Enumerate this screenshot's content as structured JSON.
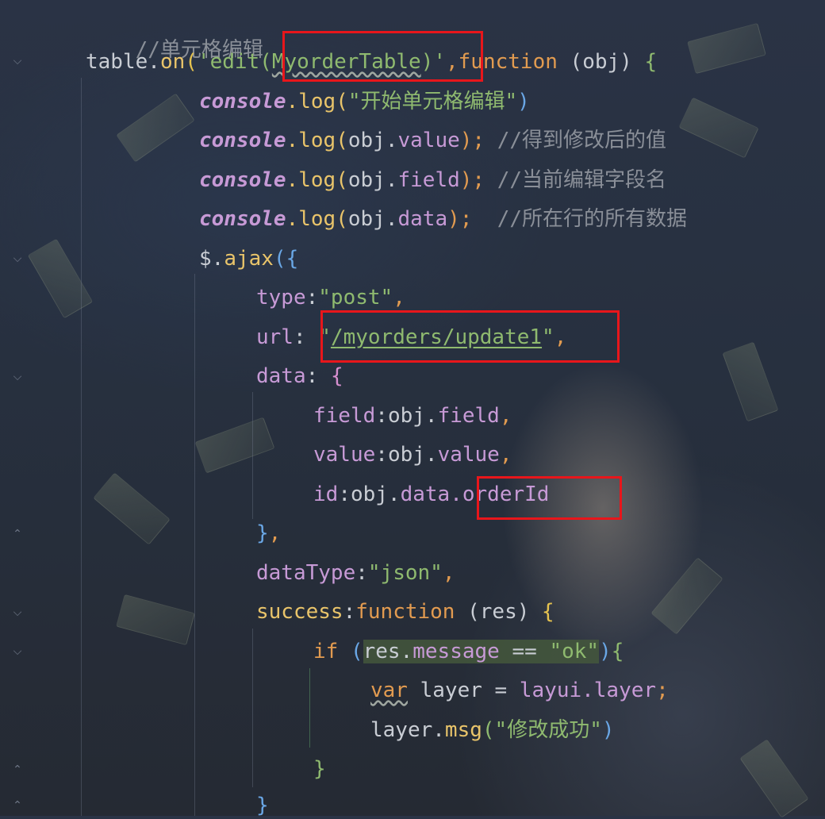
{
  "editor": {
    "comment_title": "//单元格编辑",
    "line_on": {
      "table": "table",
      "dot": ".",
      "on": "on",
      "open": "(",
      "q1": "'",
      "edit": "edit(",
      "table_name": "MyorderTable",
      "close_paren": ")",
      "q2": "'",
      "comma": ",",
      "function_kw": "function",
      "params": " (obj) ",
      "brace": "{"
    },
    "log_start": {
      "console": "console",
      "method": ".log(",
      "text": "\"开始单元格编辑\"",
      "close": ")"
    },
    "log_value": {
      "console": "console",
      "method": ".log(",
      "arg": "obj.",
      "prop": "value",
      "close": ");",
      "comment": "//得到修改后的值"
    },
    "log_field": {
      "console": "console",
      "method": ".log(",
      "arg": "obj.",
      "prop": "field",
      "close": ");",
      "comment": "//当前编辑字段名"
    },
    "log_data": {
      "console": "console",
      "method": ".log(",
      "arg": "obj.",
      "prop": "data",
      "close": ");",
      "comment": "//所在行的所有数据"
    },
    "ajax": {
      "call": "$.",
      "fn": "ajax",
      "open": "({"
    },
    "type_line": {
      "key": "type",
      "colon": ":",
      "value": "\"post\"",
      "comma": ","
    },
    "url_line": {
      "key": "url",
      "colon": ": ",
      "q_open": "\"",
      "value": "/myorders/update1",
      "q_close": "\"",
      "comma": ","
    },
    "data_line": {
      "key": "data",
      "colon": ": ",
      "brace": "{"
    },
    "field_line": {
      "key": "field",
      "colon": ":",
      "obj": "obj.",
      "prop": "field",
      "comma": ","
    },
    "value_line": {
      "key": "value",
      "colon": ":",
      "obj": "obj.",
      "prop": "value",
      "comma": ","
    },
    "id_line": {
      "key": "id",
      "colon": ":",
      "obj": "obj.",
      "mid": "data.",
      "prop": "orderId"
    },
    "data_close": {
      "brace": "}",
      "comma": ","
    },
    "datatype_line": {
      "key": "dataType",
      "colon": ":",
      "value": "\"json\"",
      "comma": ","
    },
    "success_line": {
      "key": "success",
      "colon": ":",
      "fn": "function",
      "params": " (res) ",
      "brace": "{"
    },
    "if_line": {
      "kw": "if",
      "open": " (",
      "obj": "res.",
      "prop": "message",
      "op": " == ",
      "value": "\"ok\"",
      "close": ")",
      "brace": "{"
    },
    "var_line": {
      "kw": "var",
      "name": " layer = ",
      "ns": "layui.",
      "prop": "layer",
      "semi": ";"
    },
    "msg_line": {
      "obj": "layer.",
      "fn": "msg",
      "open": "(",
      "value": "\"修改成功\"",
      "close": ")"
    },
    "if_close": {
      "brace": "}"
    },
    "success_close": {
      "brace": "}"
    }
  },
  "gutter_icons": [
    "fold-icon",
    "fold-icon",
    "fold-icon",
    "fold-icon",
    "fold-icon",
    "fold-icon",
    "fold-icon",
    "fold-icon",
    "fold-icon",
    "fold-icon"
  ],
  "colors": {
    "highlight_box": "#e8161b",
    "keyword": "#e29b50",
    "string": "#8fba6f",
    "property": "#c79ad6"
  }
}
